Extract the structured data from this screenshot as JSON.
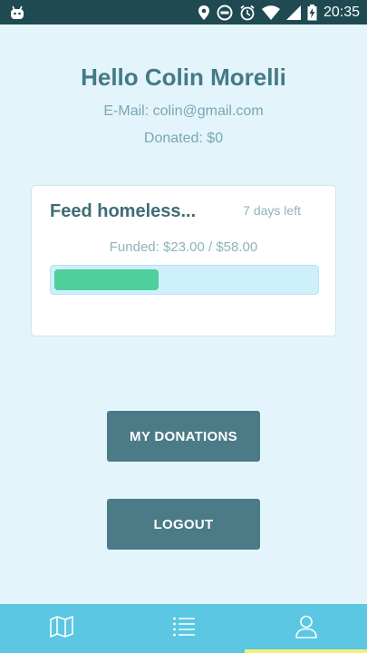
{
  "status_bar": {
    "time": "20:35",
    "icons": [
      "android-icon",
      "location-icon",
      "do-not-disturb-icon",
      "alarm-icon",
      "wifi-icon",
      "signal-icon",
      "battery-charging-icon"
    ]
  },
  "profile": {
    "greeting": "Hello Colin Morelli",
    "email": "E-Mail: colin@gmail.com",
    "donated": "Donated: $0"
  },
  "campaign": {
    "title": "Feed homeless...",
    "days_left": "7 days left",
    "funded": "Funded: $23.00 / $58.00",
    "progress_fraction": 0.4
  },
  "buttons": {
    "my_donations": "MY DONATIONS",
    "logout": "LOGOUT"
  },
  "bottom_nav": {
    "items": [
      "map-icon",
      "list-icon",
      "profile-icon"
    ],
    "active": "profile-icon"
  },
  "colors": {
    "background": "#e4f4fb",
    "status_bar": "#1f4a52",
    "accent": "#4a7b87",
    "progress": "#4ecf9c",
    "nav": "#5bc7e2",
    "nav_indicator": "#f0f07a"
  }
}
